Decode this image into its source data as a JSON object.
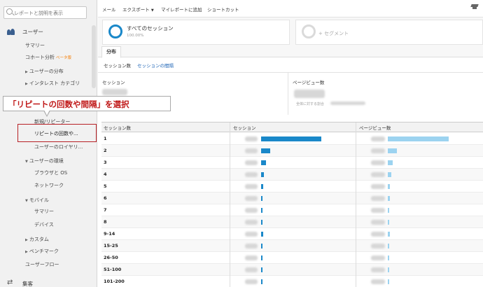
{
  "search": {
    "placeholder": "レポートと説明を表示"
  },
  "sidebar": {
    "users_header": "ユーザー",
    "acquisition_header": "集客",
    "items": [
      {
        "label": "サマリー",
        "indent": 1
      },
      {
        "label": "コホート分析",
        "badge": "ベータ版",
        "indent": 1
      },
      {
        "label": "ユーザーの分布",
        "expandable": true,
        "indent": 1
      },
      {
        "label": "インタレスト カテゴリ",
        "expandable": true,
        "indent": 1
      },
      {
        "label": "新規/リピーター",
        "indent": 2
      },
      {
        "label": "リピートの回数や...",
        "indent": 2,
        "selected": true
      },
      {
        "label": "ユーザーのロイヤリ...",
        "indent": 2
      },
      {
        "label": "ユーザーの環境",
        "expanded": true,
        "indent": 1
      },
      {
        "label": "ブラウザと OS",
        "indent": 2
      },
      {
        "label": "ネットワーク",
        "indent": 2
      },
      {
        "label": "モバイル",
        "expanded": true,
        "indent": 1
      },
      {
        "label": "サマリー",
        "indent": 2
      },
      {
        "label": "デバイス",
        "indent": 2
      },
      {
        "label": "カスタム",
        "expandable": true,
        "indent": 1
      },
      {
        "label": "ベンチマーク",
        "expandable": true,
        "indent": 1
      },
      {
        "label": "ユーザーフロー",
        "indent": 1
      }
    ]
  },
  "toolbar": {
    "email": "メール",
    "export": "エクスポート",
    "add_to_dashboard": "マイレポートに追加",
    "shortcut": "ショートカット"
  },
  "segments": {
    "all_sessions": {
      "title": "すべてのセッション",
      "percent": "100.00%"
    },
    "add_segment": "+ セグメント"
  },
  "tabs": {
    "distribution": "分布"
  },
  "subtabs": {
    "sessions_count": "セッション数",
    "session_interval": "セッションの間隔"
  },
  "summary": {
    "sessions_label": "セッション",
    "pageviews_label": "ページビュー数",
    "pageviews_sub": "全体に対する割合"
  },
  "table": {
    "headers": [
      "セッション数",
      "セッション",
      "ページビュー数"
    ],
    "rows": [
      {
        "label": "1",
        "sessions_pct": 1.0,
        "pageviews_pct": 1.0
      },
      {
        "label": "2",
        "sessions_pct": 0.155,
        "pageviews_pct": 0.15
      },
      {
        "label": "3",
        "sessions_pct": 0.085,
        "pageviews_pct": 0.085
      },
      {
        "label": "4",
        "sessions_pct": 0.05,
        "pageviews_pct": 0.055
      },
      {
        "label": "5",
        "sessions_pct": 0.035,
        "pageviews_pct": 0.04
      },
      {
        "label": "6",
        "sessions_pct": 0.028,
        "pageviews_pct": 0.03
      },
      {
        "label": "7",
        "sessions_pct": 0.022,
        "pageviews_pct": 0.025
      },
      {
        "label": "8",
        "sessions_pct": 0.02,
        "pageviews_pct": 0.022
      },
      {
        "label": "9-14",
        "sessions_pct": 0.04,
        "pageviews_pct": 0.04
      },
      {
        "label": "15-25",
        "sessions_pct": 0.025,
        "pageviews_pct": 0.025
      },
      {
        "label": "26-50",
        "sessions_pct": 0.02,
        "pageviews_pct": 0.02
      },
      {
        "label": "51-100",
        "sessions_pct": 0.015,
        "pageviews_pct": 0.015
      },
      {
        "label": "101-200",
        "sessions_pct": 0.012,
        "pageviews_pct": 0.012
      }
    ]
  },
  "annotation": {
    "text": "「リピートの回数や間隔」を選択"
  },
  "colors": {
    "sessions_bar": "#1a88c9",
    "pageviews_bar": "#9cd3f0",
    "annotation": "#c01818"
  }
}
